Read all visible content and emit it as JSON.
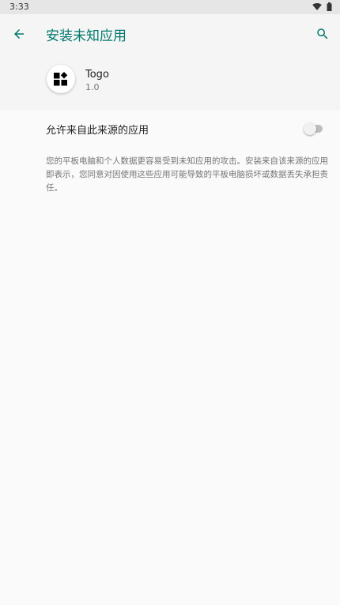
{
  "status_bar": {
    "time": "3:33",
    "icons": [
      "wifi-icon",
      "battery-icon"
    ]
  },
  "app_bar": {
    "title": "安装未知应用",
    "back_icon": "arrow-back-icon",
    "search_icon": "search-icon",
    "accent_color": "#00796b"
  },
  "app_info": {
    "name": "Togo",
    "version": "1.0",
    "icon": "widgets-icon"
  },
  "setting": {
    "label": "允许来自此来源的应用",
    "enabled": false
  },
  "warning": {
    "text": "您的平板电脑和个人数据更容易受到未知应用的攻击。安装来自该来源的应用即表示，您同意对因使用这些应用可能导致的平板电脑损坏或数据丢失承担责任。"
  }
}
